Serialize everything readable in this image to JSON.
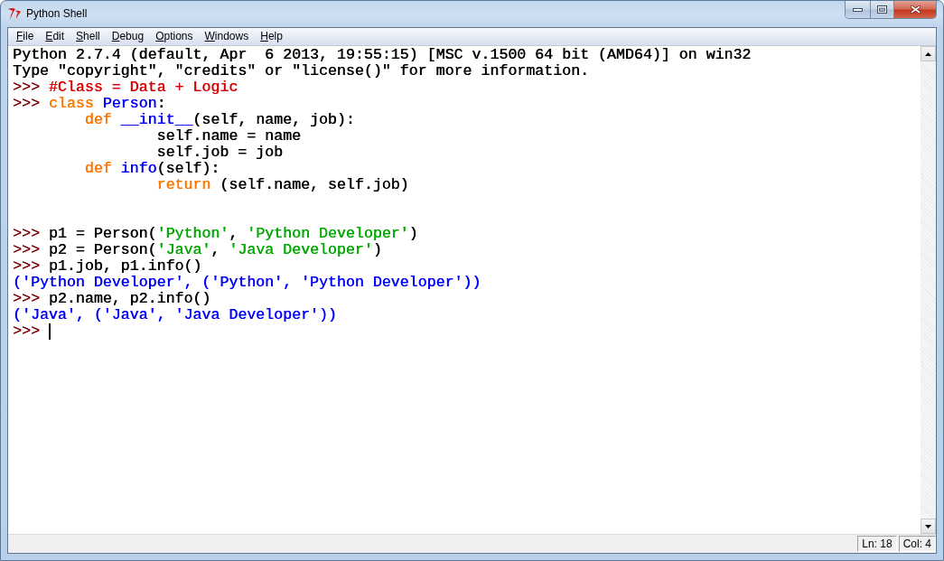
{
  "window": {
    "title": "Python Shell"
  },
  "menu": [
    {
      "label": "File"
    },
    {
      "label": "Edit"
    },
    {
      "label": "Shell"
    },
    {
      "label": "Debug"
    },
    {
      "label": "Options"
    },
    {
      "label": "Windows"
    },
    {
      "label": "Help"
    }
  ],
  "shell": {
    "lines": [
      {
        "kind": "banner",
        "text": "Python 2.7.4 (default, Apr  6 2013, 19:55:15) [MSC v.1500 64 bit (AMD64)] on win32"
      },
      {
        "kind": "banner",
        "text": "Type \"copyright\", \"credits\" or \"license()\" for more information."
      },
      {
        "kind": "input",
        "segments": [
          {
            "kind": "prompt",
            "text": ">>> "
          },
          {
            "kind": "comment",
            "text": "#Class = Data + Logic"
          }
        ]
      },
      {
        "kind": "input",
        "segments": [
          {
            "kind": "prompt",
            "text": ">>> "
          },
          {
            "kind": "keyword",
            "text": "class"
          },
          {
            "kind": "definition",
            "text": " Person"
          },
          {
            "kind": "plain",
            "text": ":"
          }
        ],
        "children": [
          {
            "kind": "input",
            "segments": [
              {
                "kind": "keyword",
                "text": "def"
              },
              {
                "kind": "definition",
                "text": " __init__"
              },
              {
                "kind": "plain",
                "text": "(self, name, job):"
              }
            ],
            "children": [
              {
                "kind": "input",
                "segments": [
                  {
                    "kind": "plain",
                    "text": "self.name = name"
                  }
                ]
              },
              {
                "kind": "input",
                "segments": [
                  {
                    "kind": "plain",
                    "text": "self.job = job"
                  }
                ]
              }
            ]
          },
          {
            "kind": "input",
            "segments": [
              {
                "kind": "keyword",
                "text": "def"
              },
              {
                "kind": "definition",
                "text": " info"
              },
              {
                "kind": "plain",
                "text": "(self):"
              }
            ],
            "children": [
              {
                "kind": "input",
                "segments": [
                  {
                    "kind": "keyword",
                    "text": "return"
                  },
                  {
                    "kind": "plain",
                    "text": " (self.name, self.job)"
                  }
                ]
              }
            ]
          }
        ]
      },
      {
        "kind": "blank"
      },
      {
        "kind": "blank"
      },
      {
        "kind": "input",
        "segments": [
          {
            "kind": "prompt",
            "text": ">>> "
          },
          {
            "kind": "plain",
            "text": "p1 = Person("
          },
          {
            "kind": "string",
            "text": "'Python'"
          },
          {
            "kind": "plain",
            "text": ", "
          },
          {
            "kind": "string",
            "text": "'Python Developer'"
          },
          {
            "kind": "plain",
            "text": ")"
          }
        ]
      },
      {
        "kind": "input",
        "segments": [
          {
            "kind": "prompt",
            "text": ">>> "
          },
          {
            "kind": "plain",
            "text": "p2 = Person("
          },
          {
            "kind": "string",
            "text": "'Java'"
          },
          {
            "kind": "plain",
            "text": ", "
          },
          {
            "kind": "string",
            "text": "'Java Developer'"
          },
          {
            "kind": "plain",
            "text": ")"
          }
        ]
      },
      {
        "kind": "input",
        "segments": [
          {
            "kind": "prompt",
            "text": ">>> "
          },
          {
            "kind": "plain",
            "text": "p1.job, p1.info()"
          }
        ]
      },
      {
        "kind": "stdout",
        "text": "('Python Developer', ('Python', 'Python Developer'))"
      },
      {
        "kind": "input",
        "segments": [
          {
            "kind": "prompt",
            "text": ">>> "
          },
          {
            "kind": "plain",
            "text": "p2.name, p2.info()"
          }
        ]
      },
      {
        "kind": "stdout",
        "text": "('Java', ('Java', 'Java Developer'))"
      },
      {
        "kind": "input",
        "segments": [
          {
            "kind": "prompt",
            "text": ">>> "
          },
          {
            "kind": "cursor"
          }
        ]
      }
    ]
  },
  "status_bar": {
    "line": "Ln: 18",
    "column": "Col: 4"
  }
}
